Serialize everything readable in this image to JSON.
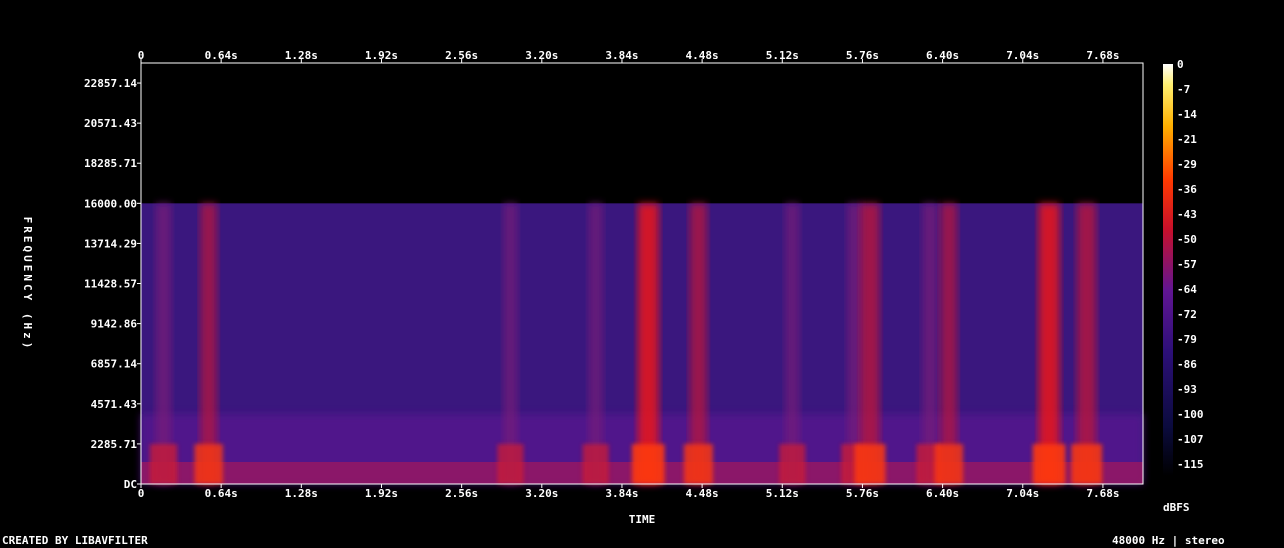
{
  "footer": {
    "left": "CREATED BY LIBAVFILTER",
    "right": "48000 Hz | stereo"
  },
  "chart_data": {
    "type": "heatmap",
    "title": "",
    "xlabel": "TIME",
    "ylabel": "FREQUENCY (Hz)",
    "x_ticks": [
      "0",
      "0.64s",
      "1.28s",
      "1.92s",
      "2.56s",
      "3.20s",
      "3.84s",
      "4.48s",
      "5.12s",
      "5.76s",
      "6.40s",
      "7.04s",
      "7.68s"
    ],
    "x_tick_values": [
      0,
      0.64,
      1.28,
      1.92,
      2.56,
      3.2,
      3.84,
      4.48,
      5.12,
      5.76,
      6.4,
      7.04,
      7.68
    ],
    "xlim": [
      0,
      8.0
    ],
    "y_ticks": [
      "DC",
      "2285.71",
      "4571.43",
      "6857.14",
      "9142.86",
      "11428.57",
      "13714.29",
      "16000.00",
      "18285.71",
      "20571.43",
      "22857.14"
    ],
    "y_tick_values": [
      0,
      2285.71,
      4571.43,
      6857.14,
      9142.86,
      11428.57,
      13714.29,
      16000.0,
      18285.71,
      20571.43,
      22857.14
    ],
    "ylim": [
      0,
      24000
    ],
    "content_cutoff_hz": 16000,
    "colorbar": {
      "label": "dBFS",
      "ticks": [
        "0",
        "-7",
        "-14",
        "-21",
        "-29",
        "-36",
        "-43",
        "-50",
        "-57",
        "-64",
        "-72",
        "-79",
        "-86",
        "-93",
        "-100",
        "-107",
        "-115"
      ],
      "range": [
        -120,
        0
      ],
      "colormap": "intensity (black-navy-purple-red-orange-yellow-white)"
    },
    "activity_bursts_s": [
      {
        "t": 0.18,
        "level": 0.45
      },
      {
        "t": 0.54,
        "level": 0.55
      },
      {
        "t": 2.95,
        "level": 0.35
      },
      {
        "t": 3.63,
        "level": 0.35
      },
      {
        "t": 4.05,
        "level": 0.9
      },
      {
        "t": 4.45,
        "level": 0.6
      },
      {
        "t": 5.2,
        "level": 0.35
      },
      {
        "t": 5.7,
        "level": 0.45
      },
      {
        "t": 5.82,
        "level": 0.75
      },
      {
        "t": 6.3,
        "level": 0.45
      },
      {
        "t": 6.45,
        "level": 0.55
      },
      {
        "t": 7.25,
        "level": 0.9
      },
      {
        "t": 7.55,
        "level": 0.75
      }
    ]
  }
}
